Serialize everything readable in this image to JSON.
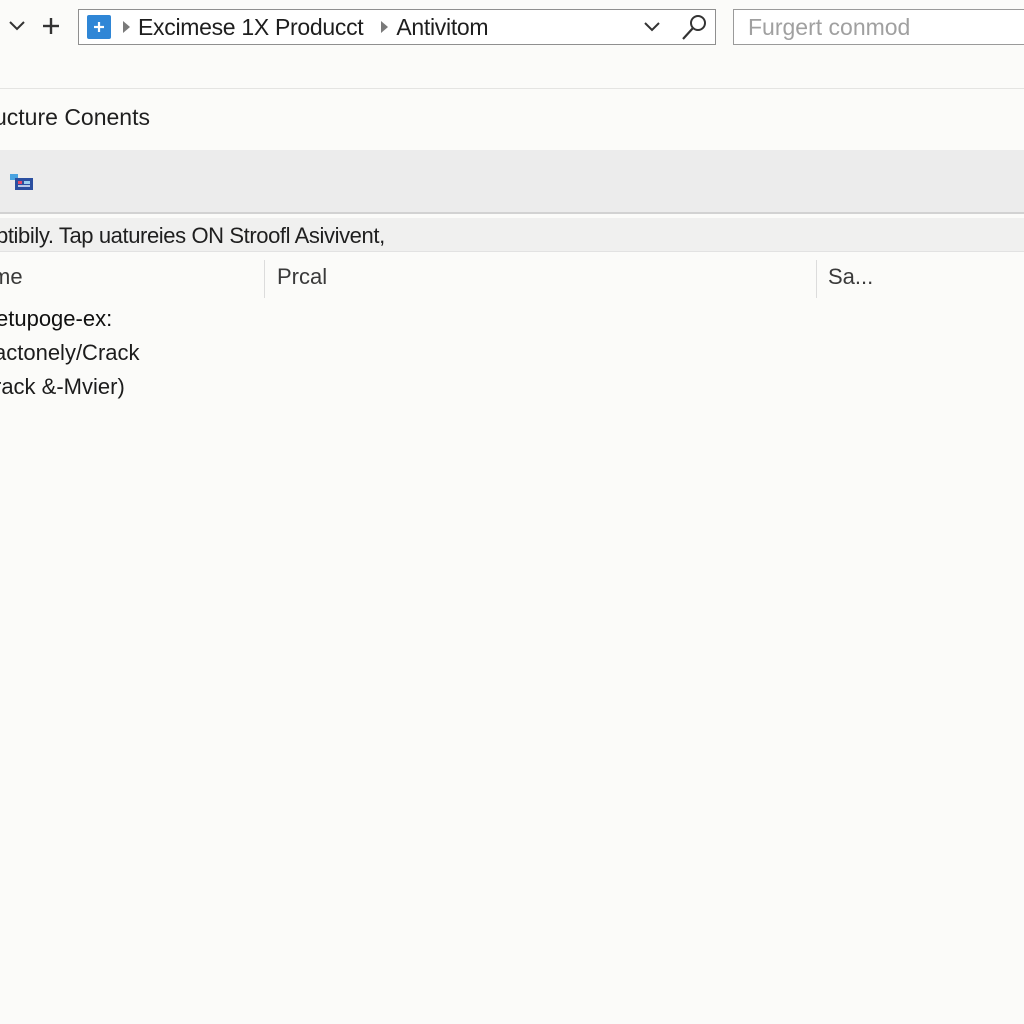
{
  "nav": {
    "back_glyph": "⌄",
    "new_glyph": "+"
  },
  "address_bar": {
    "icon": "folder-plus-icon",
    "crumbs": [
      "Excimese 1X Producct",
      "Antivitom"
    ]
  },
  "search": {
    "placeholder": "Furgert conmod"
  },
  "page": {
    "title": "ucture Conents"
  },
  "toolbar": {
    "icon": "view-icon"
  },
  "status": {
    "text": "ptibily. Tap uatureies ON Stroofl Asivivent,"
  },
  "columns": {
    "name": "me",
    "second": "Prcal",
    "third": "Sa..."
  },
  "files": [
    "etupoge-ex:",
    "actonely/Crack",
    "rack &-Mvier)"
  ],
  "colors": {
    "accent": "#2f86d6",
    "toolbar_bg": "#ececec"
  }
}
